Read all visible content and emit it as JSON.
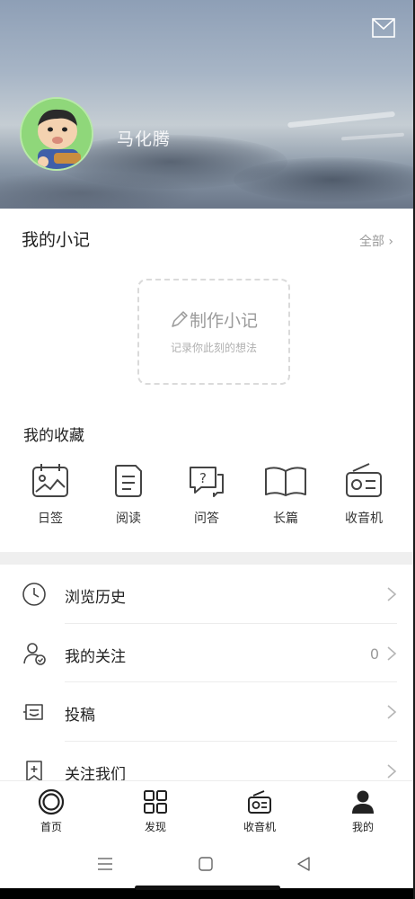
{
  "header": {
    "username": "马化腾",
    "mail_icon": "mail-icon",
    "avatar": "avatar-cartoon"
  },
  "notes": {
    "title": "我的小记",
    "all_label": "全部 ›",
    "make_label": "制作小记",
    "make_sub": "记录你此刻的想法"
  },
  "favorites": {
    "title": "我的收藏",
    "items": [
      {
        "label": "日签",
        "icon": "calendar-picture-icon"
      },
      {
        "label": "阅读",
        "icon": "document-icon"
      },
      {
        "label": "问答",
        "icon": "question-chat-icon"
      },
      {
        "label": "长篇",
        "icon": "open-book-icon"
      },
      {
        "label": "收音机",
        "icon": "radio-icon"
      }
    ]
  },
  "menu": [
    {
      "label": "浏览历史",
      "value": "",
      "icon": "clock-icon"
    },
    {
      "label": "我的关注",
      "value": "0",
      "icon": "user-follow-icon"
    },
    {
      "label": "投稿",
      "value": "",
      "icon": "submit-icon"
    },
    {
      "label": "关注我们",
      "value": "",
      "icon": "bookmark-plus-icon"
    }
  ],
  "bottom_nav": [
    {
      "label": "首页",
      "icon": "home-circle-icon"
    },
    {
      "label": "发现",
      "icon": "grid-icon"
    },
    {
      "label": "收音机",
      "icon": "radio-icon"
    },
    {
      "label": "我的",
      "icon": "person-icon"
    }
  ],
  "colors": {
    "text": "#222222",
    "muted": "#9a9a9a",
    "divider": "#ececec",
    "section_gap": "#efefef"
  }
}
